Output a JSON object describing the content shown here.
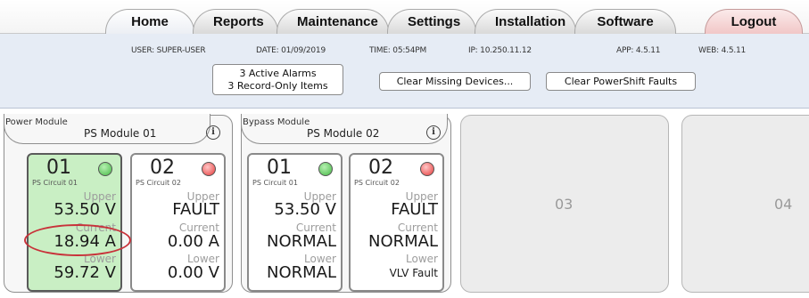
{
  "tabs": {
    "home": "Home",
    "reports": "Reports",
    "maintenance": "Maintenance",
    "settings": "Settings",
    "installation": "Installation",
    "software": "Software",
    "logout": "Logout"
  },
  "status": {
    "user": "USER: SUPER-USER",
    "date": "DATE: 01/09/2019",
    "time": "TIME: 05:54PM",
    "ip": "IP: 10.250.11.12",
    "app": "APP: 4.5.11",
    "web": "WEB: 4.5.11"
  },
  "buttons": {
    "alarms_line1": "3 Active Alarms",
    "alarms_line2": "3 Record-Only Items",
    "clear_missing": "Clear Missing Devices...",
    "clear_faults": "Clear PowerShift Faults"
  },
  "power_module": {
    "type": "Power Module",
    "name": "PS Module 01",
    "info": "i",
    "circuits": [
      {
        "num": "01",
        "status": "green",
        "name": "PS Circuit 01",
        "upper_label": "Upper",
        "upper": "53.50 V",
        "current_label": "Current",
        "current": "18.94 A",
        "lower_label": "Lower",
        "lower": "59.72 V"
      },
      {
        "num": "02",
        "status": "red",
        "name": "PS Circuit 02",
        "upper_label": "Upper",
        "upper": "FAULT",
        "current_label": "Current",
        "current": "0.00 A",
        "lower_label": "Lower",
        "lower": "0.00 V"
      }
    ]
  },
  "bypass_module": {
    "type": "Bypass Module",
    "name": "PS Module 02",
    "info": "i",
    "circuits": [
      {
        "num": "01",
        "status": "green",
        "name": "PS Circuit 01",
        "upper_label": "Upper",
        "upper": "53.50 V",
        "current_label": "Current",
        "current": "NORMAL",
        "lower_label": "Lower",
        "lower": "NORMAL"
      },
      {
        "num": "02",
        "status": "red",
        "name": "PS Circuit 02",
        "upper_label": "Upper",
        "upper": "FAULT",
        "current_label": "Current",
        "current": "NORMAL",
        "lower_label": "Lower",
        "lower": "VLV Fault"
      }
    ]
  },
  "empty_slots": [
    "03",
    "04"
  ],
  "colors": {
    "status_green": "#46b946",
    "status_red": "#e63a3a",
    "active_card": "#c9efc4",
    "highlight": "#c8323a"
  }
}
